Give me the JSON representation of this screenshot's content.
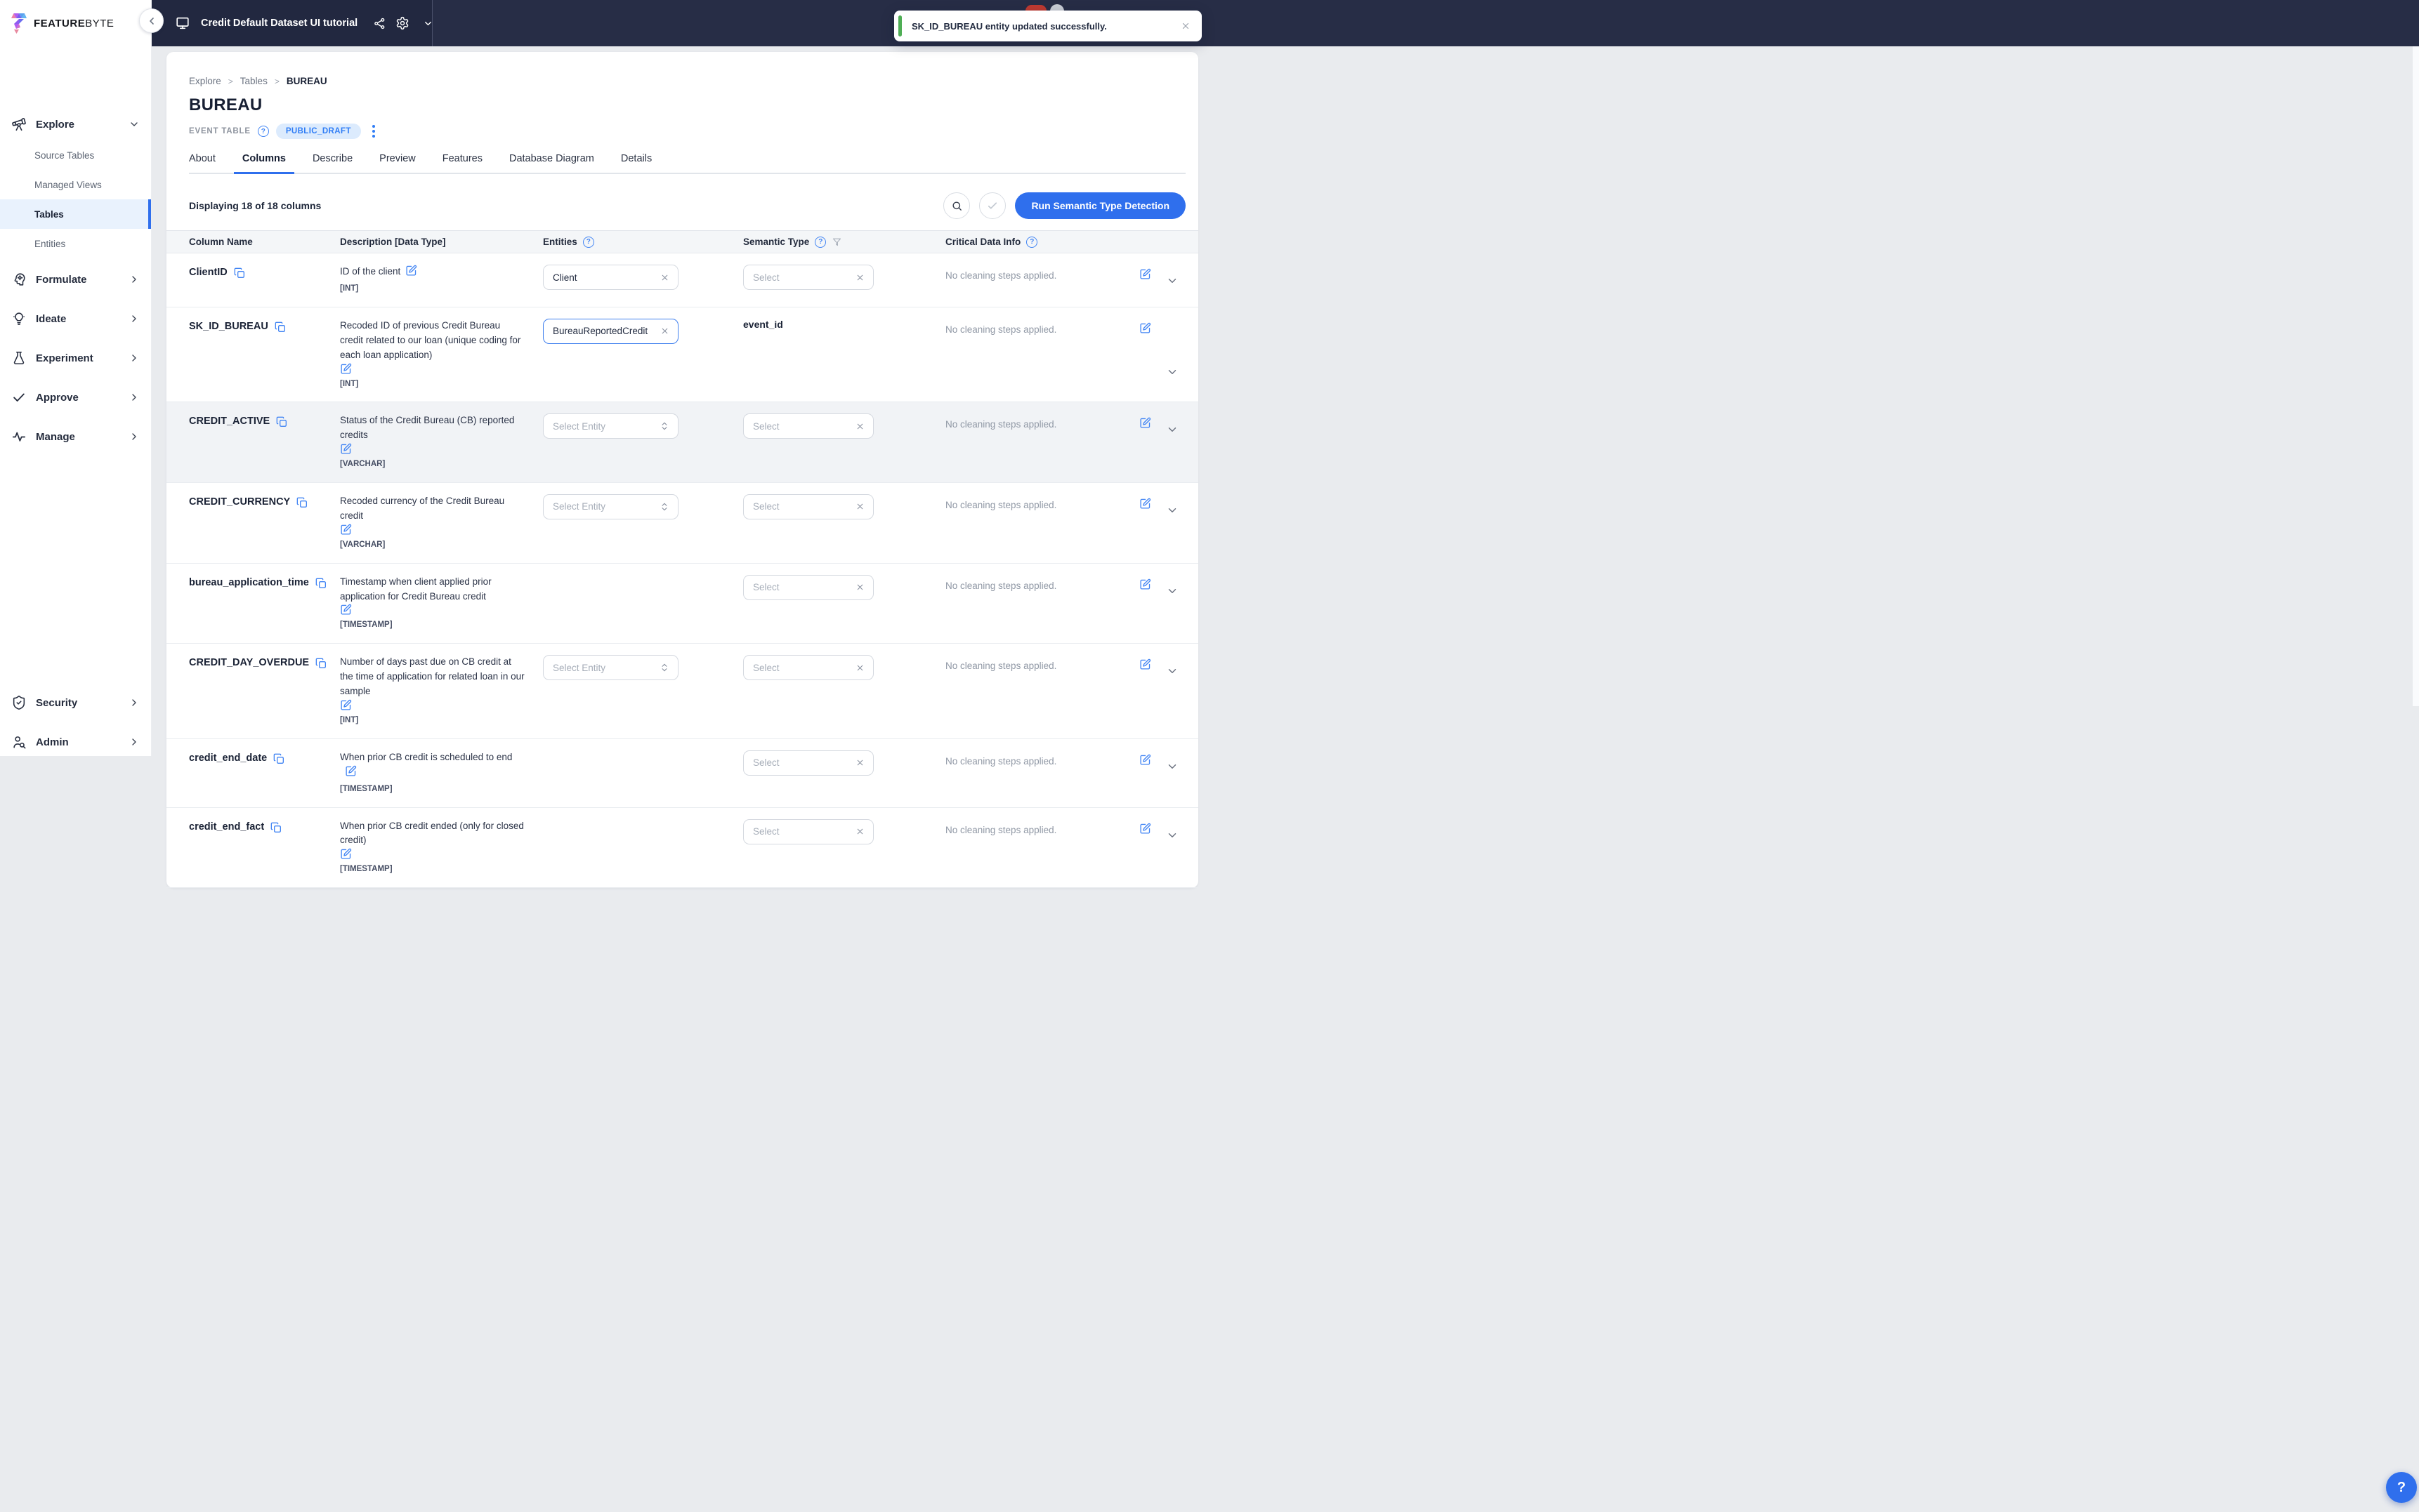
{
  "colors": {
    "accent": "#2f6fed",
    "topbar": "#272d46",
    "toast_green": "#4fae55",
    "badge_red": "#bf3a31",
    "active_item_bg": "#e9f2fd"
  },
  "brand": {
    "name_bold": "FEATURE",
    "name_light": "BYTE"
  },
  "topbar": {
    "project_title": "Credit Default Dataset UI tutorial"
  },
  "toast": {
    "message": "SK_ID_BUREAU entity updated successfully."
  },
  "sidebar": {
    "explore_group": {
      "label": "Explore",
      "items": [
        {
          "label": "Source Tables",
          "active": false
        },
        {
          "label": "Managed Views",
          "active": false
        },
        {
          "label": "Tables",
          "active": true
        },
        {
          "label": "Entities",
          "active": false
        }
      ]
    },
    "sections": [
      {
        "label": "Formulate",
        "icon": "head-gear-icon"
      },
      {
        "label": "Ideate",
        "icon": "lightbulb-icon"
      },
      {
        "label": "Experiment",
        "icon": "flask-icon"
      },
      {
        "label": "Approve",
        "icon": "check-icon"
      },
      {
        "label": "Manage",
        "icon": "activity-icon"
      }
    ],
    "bottom_sections": [
      {
        "label": "Security",
        "icon": "shield-check-icon"
      },
      {
        "label": "Admin",
        "icon": "user-search-icon"
      }
    ]
  },
  "page": {
    "breadcrumb": [
      "Explore",
      "Tables",
      "BUREAU"
    ],
    "title": "BUREAU",
    "type_label": "EVENT TABLE",
    "status_badge": "PUBLIC_DRAFT",
    "tabs": [
      {
        "label": "About",
        "active": false
      },
      {
        "label": "Columns",
        "active": true
      },
      {
        "label": "Describe",
        "active": false
      },
      {
        "label": "Preview",
        "active": false
      },
      {
        "label": "Features",
        "active": false
      },
      {
        "label": "Database Diagram",
        "active": false
      },
      {
        "label": "Details",
        "active": false
      }
    ],
    "toolbar": {
      "displaying": "Displaying 18 of 18 columns",
      "run_button": "Run Semantic Type Detection"
    },
    "table": {
      "headers": {
        "column_name": "Column Name",
        "description": "Description [Data Type]",
        "entities": "Entities",
        "semantic_type": "Semantic Type",
        "critical": "Critical Data Info"
      },
      "select_placeholder": "Select",
      "select_entity_placeholder": "Select Entity",
      "rows": [
        {
          "name": "ClientID",
          "description": "ID of the client",
          "inline_edit": true,
          "dtype": "[INT]",
          "entity": {
            "type": "value",
            "value": "Client",
            "focused": false
          },
          "semantic": {
            "type": "select"
          },
          "cleaning": "No cleaning steps applied.",
          "highlight": false,
          "chevron_low": false
        },
        {
          "name": "SK_ID_BUREAU",
          "description": "Recoded ID of previous Credit Bureau credit related to our loan (unique coding for each loan application)",
          "inline_edit": false,
          "dtype": "[INT]",
          "entity": {
            "type": "value",
            "value": "BureauReportedCredit",
            "focused": true
          },
          "semantic": {
            "type": "text",
            "value": "event_id"
          },
          "cleaning": "No cleaning steps applied.",
          "highlight": false,
          "chevron_low": true
        },
        {
          "name": "CREDIT_ACTIVE",
          "description": "Status of the Credit Bureau (CB) reported credits",
          "inline_edit": false,
          "dtype": "[VARCHAR]",
          "entity": {
            "type": "dropdown"
          },
          "semantic": {
            "type": "select"
          },
          "cleaning": "No cleaning steps applied.",
          "highlight": true,
          "chevron_low": false
        },
        {
          "name": "CREDIT_CURRENCY",
          "description": "Recoded currency of the Credit Bureau credit",
          "inline_edit": false,
          "dtype": "[VARCHAR]",
          "entity": {
            "type": "dropdown"
          },
          "semantic": {
            "type": "select"
          },
          "cleaning": "No cleaning steps applied.",
          "highlight": false,
          "chevron_low": false
        },
        {
          "name": "bureau_application_time",
          "description": "Timestamp when client applied prior application for Credit Bureau credit",
          "inline_edit": false,
          "dtype": "[TIMESTAMP]",
          "entity": null,
          "semantic": {
            "type": "select"
          },
          "cleaning": "No cleaning steps applied.",
          "highlight": false,
          "chevron_low": false
        },
        {
          "name": "CREDIT_DAY_OVERDUE",
          "description": "Number of days past due on CB credit at the time of application for related loan in our sample",
          "inline_edit": false,
          "dtype": "[INT]",
          "entity": {
            "type": "dropdown"
          },
          "semantic": {
            "type": "select"
          },
          "cleaning": "No cleaning steps applied.",
          "highlight": false,
          "chevron_low": false
        },
        {
          "name": "credit_end_date",
          "description": "When prior CB credit is scheduled to end",
          "inline_edit": true,
          "dtype": "[TIMESTAMP]",
          "entity": null,
          "semantic": {
            "type": "select"
          },
          "cleaning": "No cleaning steps applied.",
          "highlight": false,
          "chevron_low": false
        },
        {
          "name": "credit_end_fact",
          "description": "When prior CB credit ended (only for closed credit)",
          "inline_edit": false,
          "dtype": "[TIMESTAMP]",
          "entity": null,
          "semantic": {
            "type": "select"
          },
          "cleaning": "No cleaning steps applied.",
          "highlight": false,
          "chevron_low": false
        }
      ]
    }
  },
  "help_button": "?"
}
